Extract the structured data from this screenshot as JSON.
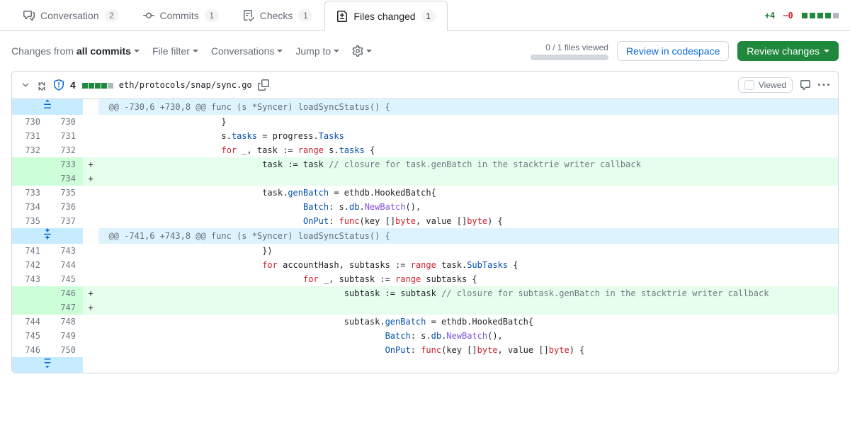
{
  "tabs": [
    {
      "icon": "comment",
      "label": "Conversation",
      "count": "2"
    },
    {
      "icon": "commit",
      "label": "Commits",
      "count": "1"
    },
    {
      "icon": "checklist",
      "label": "Checks",
      "count": "1"
    },
    {
      "icon": "diff",
      "label": "Files changed",
      "count": "1"
    }
  ],
  "diff_summary": {
    "additions": "+4",
    "deletions": "−0"
  },
  "toolbar": {
    "changes_from_prefix": "Changes from ",
    "changes_from_value": "all commits",
    "file_filter": "File filter",
    "conversations": "Conversations",
    "jump_to": "Jump to",
    "files_viewed": "0 / 1 files viewed",
    "review_codespace": "Review in codespace",
    "review_changes": "Review changes"
  },
  "file": {
    "changes": "4",
    "path": "eth/protocols/snap/sync.go",
    "viewed_label": "Viewed"
  },
  "hunks": [
    {
      "header": "@@ -730,6 +730,8 @@ func (s *Syncer) loadSyncStatus() {"
    },
    {
      "header": "@@ -741,6 +743,8 @@ func (s *Syncer) loadSyncStatus() {"
    }
  ],
  "lines1": [
    {
      "l": "730",
      "r": "730",
      "m": "",
      "tokens": [
        {
          "t": "                        }",
          "c": ""
        }
      ]
    },
    {
      "l": "731",
      "r": "731",
      "m": "",
      "tokens": [
        {
          "t": "                        s.",
          "c": ""
        },
        {
          "t": "tasks",
          "c": "s"
        },
        {
          "t": " = progress.",
          "c": ""
        },
        {
          "t": "Tasks",
          "c": "s"
        }
      ]
    },
    {
      "l": "732",
      "r": "732",
      "m": "",
      "tokens": [
        {
          "t": "                        ",
          "c": ""
        },
        {
          "t": "for",
          "c": "k"
        },
        {
          "t": " _, task := ",
          "c": ""
        },
        {
          "t": "range",
          "c": "k"
        },
        {
          "t": " s.",
          "c": ""
        },
        {
          "t": "tasks",
          "c": "s"
        },
        {
          "t": " {",
          "c": ""
        }
      ]
    },
    {
      "l": "",
      "r": "733",
      "m": "+",
      "add": true,
      "tokens": [
        {
          "t": "                                task := task ",
          "c": ""
        },
        {
          "t": "// closure for task.genBatch in the stacktrie writer callback",
          "c": "cm"
        }
      ]
    },
    {
      "l": "",
      "r": "734",
      "m": "+",
      "add": true,
      "tokens": [
        {
          "t": "",
          "c": ""
        }
      ]
    },
    {
      "l": "733",
      "r": "735",
      "m": "",
      "tokens": [
        {
          "t": "                                task.",
          "c": ""
        },
        {
          "t": "genBatch",
          "c": "s"
        },
        {
          "t": " = ethdb.HookedBatch{",
          "c": ""
        }
      ]
    },
    {
      "l": "734",
      "r": "736",
      "m": "",
      "tokens": [
        {
          "t": "                                        ",
          "c": ""
        },
        {
          "t": "Batch",
          "c": "s"
        },
        {
          "t": ": s.",
          "c": ""
        },
        {
          "t": "db",
          "c": "s"
        },
        {
          "t": ".",
          "c": ""
        },
        {
          "t": "NewBatch",
          "c": "fn"
        },
        {
          "t": "(),",
          "c": ""
        }
      ]
    },
    {
      "l": "735",
      "r": "737",
      "m": "",
      "tokens": [
        {
          "t": "                                        ",
          "c": ""
        },
        {
          "t": "OnPut",
          "c": "s"
        },
        {
          "t": ": ",
          "c": ""
        },
        {
          "t": "func",
          "c": "k"
        },
        {
          "t": "(key []",
          "c": ""
        },
        {
          "t": "byte",
          "c": "k"
        },
        {
          "t": ", value []",
          "c": ""
        },
        {
          "t": "byte",
          "c": "k"
        },
        {
          "t": ") {",
          "c": ""
        }
      ]
    }
  ],
  "lines2": [
    {
      "l": "741",
      "r": "743",
      "m": "",
      "tokens": [
        {
          "t": "                                })",
          "c": ""
        }
      ]
    },
    {
      "l": "742",
      "r": "744",
      "m": "",
      "tokens": [
        {
          "t": "                                ",
          "c": ""
        },
        {
          "t": "for",
          "c": "k"
        },
        {
          "t": " accountHash, subtasks := ",
          "c": ""
        },
        {
          "t": "range",
          "c": "k"
        },
        {
          "t": " task.",
          "c": ""
        },
        {
          "t": "SubTasks",
          "c": "s"
        },
        {
          "t": " {",
          "c": ""
        }
      ]
    },
    {
      "l": "743",
      "r": "745",
      "m": "",
      "tokens": [
        {
          "t": "                                        ",
          "c": ""
        },
        {
          "t": "for",
          "c": "k"
        },
        {
          "t": " _, subtask := ",
          "c": ""
        },
        {
          "t": "range",
          "c": "k"
        },
        {
          "t": " subtasks {",
          "c": ""
        }
      ]
    },
    {
      "l": "",
      "r": "746",
      "m": "+",
      "add": true,
      "tokens": [
        {
          "t": "                                                subtask := subtask ",
          "c": ""
        },
        {
          "t": "// closure for subtask.genBatch in the stacktrie writer callback",
          "c": "cm"
        }
      ]
    },
    {
      "l": "",
      "r": "747",
      "m": "+",
      "add": true,
      "tokens": [
        {
          "t": "",
          "c": ""
        }
      ]
    },
    {
      "l": "744",
      "r": "748",
      "m": "",
      "tokens": [
        {
          "t": "                                                subtask.",
          "c": ""
        },
        {
          "t": "genBatch",
          "c": "s"
        },
        {
          "t": " = ethdb.HookedBatch{",
          "c": ""
        }
      ]
    },
    {
      "l": "745",
      "r": "749",
      "m": "",
      "tokens": [
        {
          "t": "                                                        ",
          "c": ""
        },
        {
          "t": "Batch",
          "c": "s"
        },
        {
          "t": ": s.",
          "c": ""
        },
        {
          "t": "db",
          "c": "s"
        },
        {
          "t": ".",
          "c": ""
        },
        {
          "t": "NewBatch",
          "c": "fn"
        },
        {
          "t": "(),",
          "c": ""
        }
      ]
    },
    {
      "l": "746",
      "r": "750",
      "m": "",
      "tokens": [
        {
          "t": "                                                        ",
          "c": ""
        },
        {
          "t": "OnPut",
          "c": "s"
        },
        {
          "t": ": ",
          "c": ""
        },
        {
          "t": "func",
          "c": "k"
        },
        {
          "t": "(key []",
          "c": ""
        },
        {
          "t": "byte",
          "c": "k"
        },
        {
          "t": ", value []",
          "c": ""
        },
        {
          "t": "byte",
          "c": "k"
        },
        {
          "t": ") {",
          "c": ""
        }
      ]
    }
  ]
}
